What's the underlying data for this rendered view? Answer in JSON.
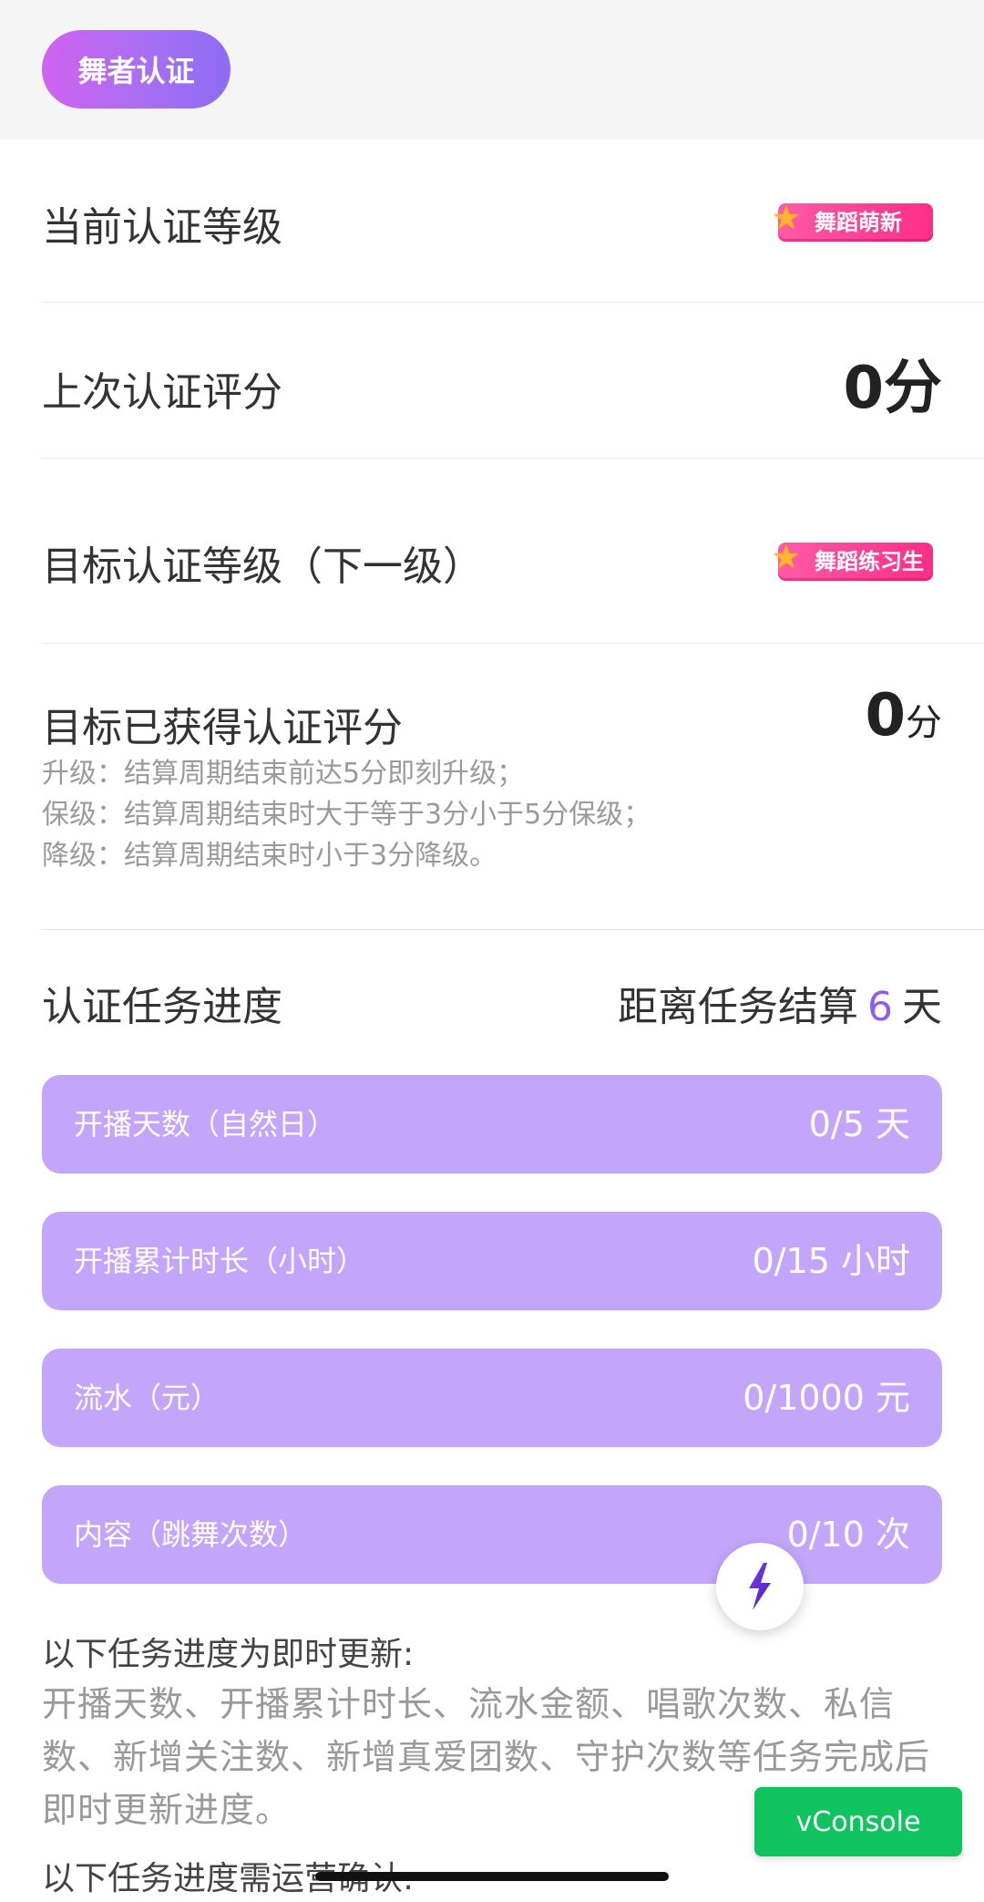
{
  "header": {
    "chip_label": "舞者认证"
  },
  "rows": {
    "current_level": {
      "label": "当前认证等级",
      "badge": "舞蹈萌新"
    },
    "last_score": {
      "label": "上次认证评分",
      "score": "0",
      "unit": "分"
    },
    "target_level": {
      "label": "目标认证等级（下一级）",
      "badge": "舞蹈练习生"
    },
    "target_score": {
      "label": "目标已获得认证评分",
      "score": "0",
      "unit": "分"
    }
  },
  "rules": [
    "升级：结算周期结束前达5分即刻升级；",
    "保级：结算周期结束时大于等于3分小于5分保级；",
    "降级：结算周期结束时小于3分降级。"
  ],
  "progress": {
    "title": "认证任务进度",
    "countdown_prefix": "距离任务结算",
    "countdown_days": "6",
    "countdown_suffix": "天",
    "tasks": [
      {
        "name": "开播天数（自然日）",
        "value": "0/5 天"
      },
      {
        "name": "开播累计时长（小时）",
        "value": "0/15 小时"
      },
      {
        "name": "流水（元）",
        "value": "0/1000 元"
      },
      {
        "name": "内容（跳舞次数）",
        "value": "0/10 次"
      }
    ]
  },
  "notes": {
    "instant_title": "以下任务进度为即时更新:",
    "instant_body": "开播天数、开播累计时长、流水金额、唱歌次数、私信数、新增关注数、新增真爱团数、守护次数等任务完成后即时更新进度。",
    "manual_title": "以下任务进度需运营确认:"
  },
  "floating": {
    "fab_icon": "lightning-icon",
    "vconsole_label": "vConsole"
  },
  "colors": {
    "accent": "#8f5bf5",
    "card": "#c3a6fb",
    "badge": "#ff2e86",
    "vconsole": "#0fc45f"
  }
}
